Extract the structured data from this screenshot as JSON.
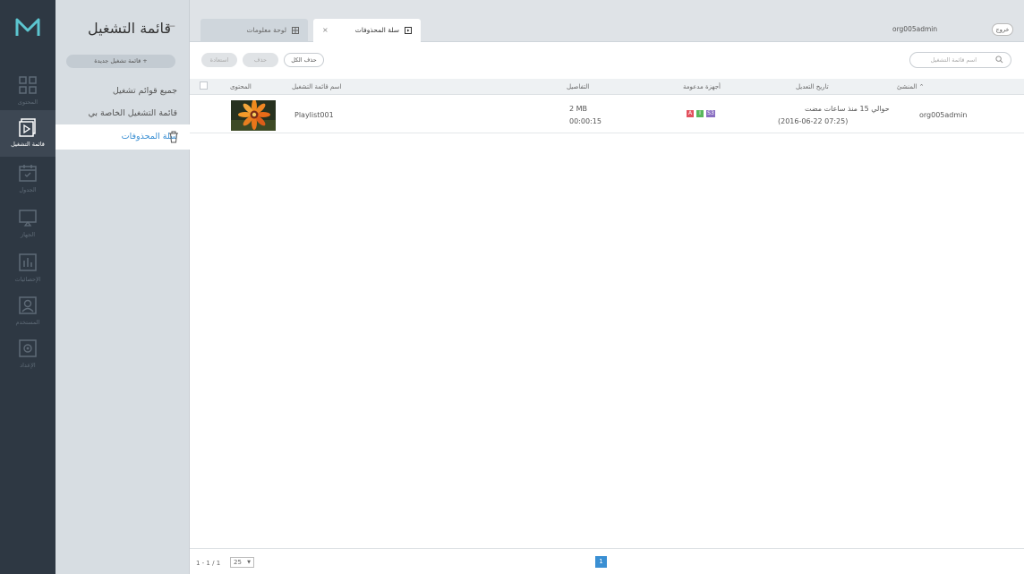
{
  "rail": {
    "items": [
      {
        "label": "المحتوى",
        "icon": "content-grid-icon"
      },
      {
        "label": "قائمة التشغيل",
        "icon": "playlist-icon"
      },
      {
        "label": "الجدول",
        "icon": "schedule-icon"
      },
      {
        "label": "الجهاز",
        "icon": "device-icon"
      },
      {
        "label": "الإحصائيات",
        "icon": "statistics-icon"
      },
      {
        "label": "المستخدم",
        "icon": "user-icon"
      },
      {
        "label": "الإعداد",
        "icon": "settings-icon"
      }
    ]
  },
  "submenu": {
    "title": "قائمة التشغيل",
    "new_button": "قائمة تشغيل جديدة  +",
    "items": [
      {
        "label": "جميع قوائم تشغيل"
      },
      {
        "label": "قائمة التشغيل الخاصة بي"
      },
      {
        "label": "سلة المحذوفات"
      }
    ]
  },
  "header": {
    "tabs": [
      {
        "label": "لوحة معلومات"
      },
      {
        "label": "سلة المحذوفات",
        "close": "×"
      }
    ],
    "user": "org005admin",
    "logout": "خروج"
  },
  "toolbar": {
    "restore": "استعادة",
    "delete": "حذف",
    "delete_all": "حذف الكل",
    "search_placeholder": "اسم قائمة التشغيل"
  },
  "table": {
    "headers": {
      "content": "المحتوى",
      "name": "اسم قائمة التشغيل",
      "details": "التفاصيل",
      "devices": "أجهزة مدعومة",
      "modified": "تاريخ التعديل",
      "creator": "المنشئ"
    },
    "rows": [
      {
        "name": "Playlist001",
        "size": "2 MB",
        "duration": "00:00:15",
        "devices": [
          "A",
          "I",
          "S3"
        ],
        "modified_relative": "حوالي 15 منذ ساعات مضت",
        "modified_date": "(2016-06-22 07:25)",
        "creator": "org005admin"
      }
    ]
  },
  "footer": {
    "range": "1 - 1 / 1",
    "page_size": "25",
    "current_page": "1"
  },
  "colors": {
    "rail_bg": "#2e3843",
    "submenu_bg": "#d7dde2",
    "accent": "#3a8fd3",
    "badge_a": "#e2525e",
    "badge_i": "#58b85c",
    "badge_s": "#8a6fc2"
  }
}
